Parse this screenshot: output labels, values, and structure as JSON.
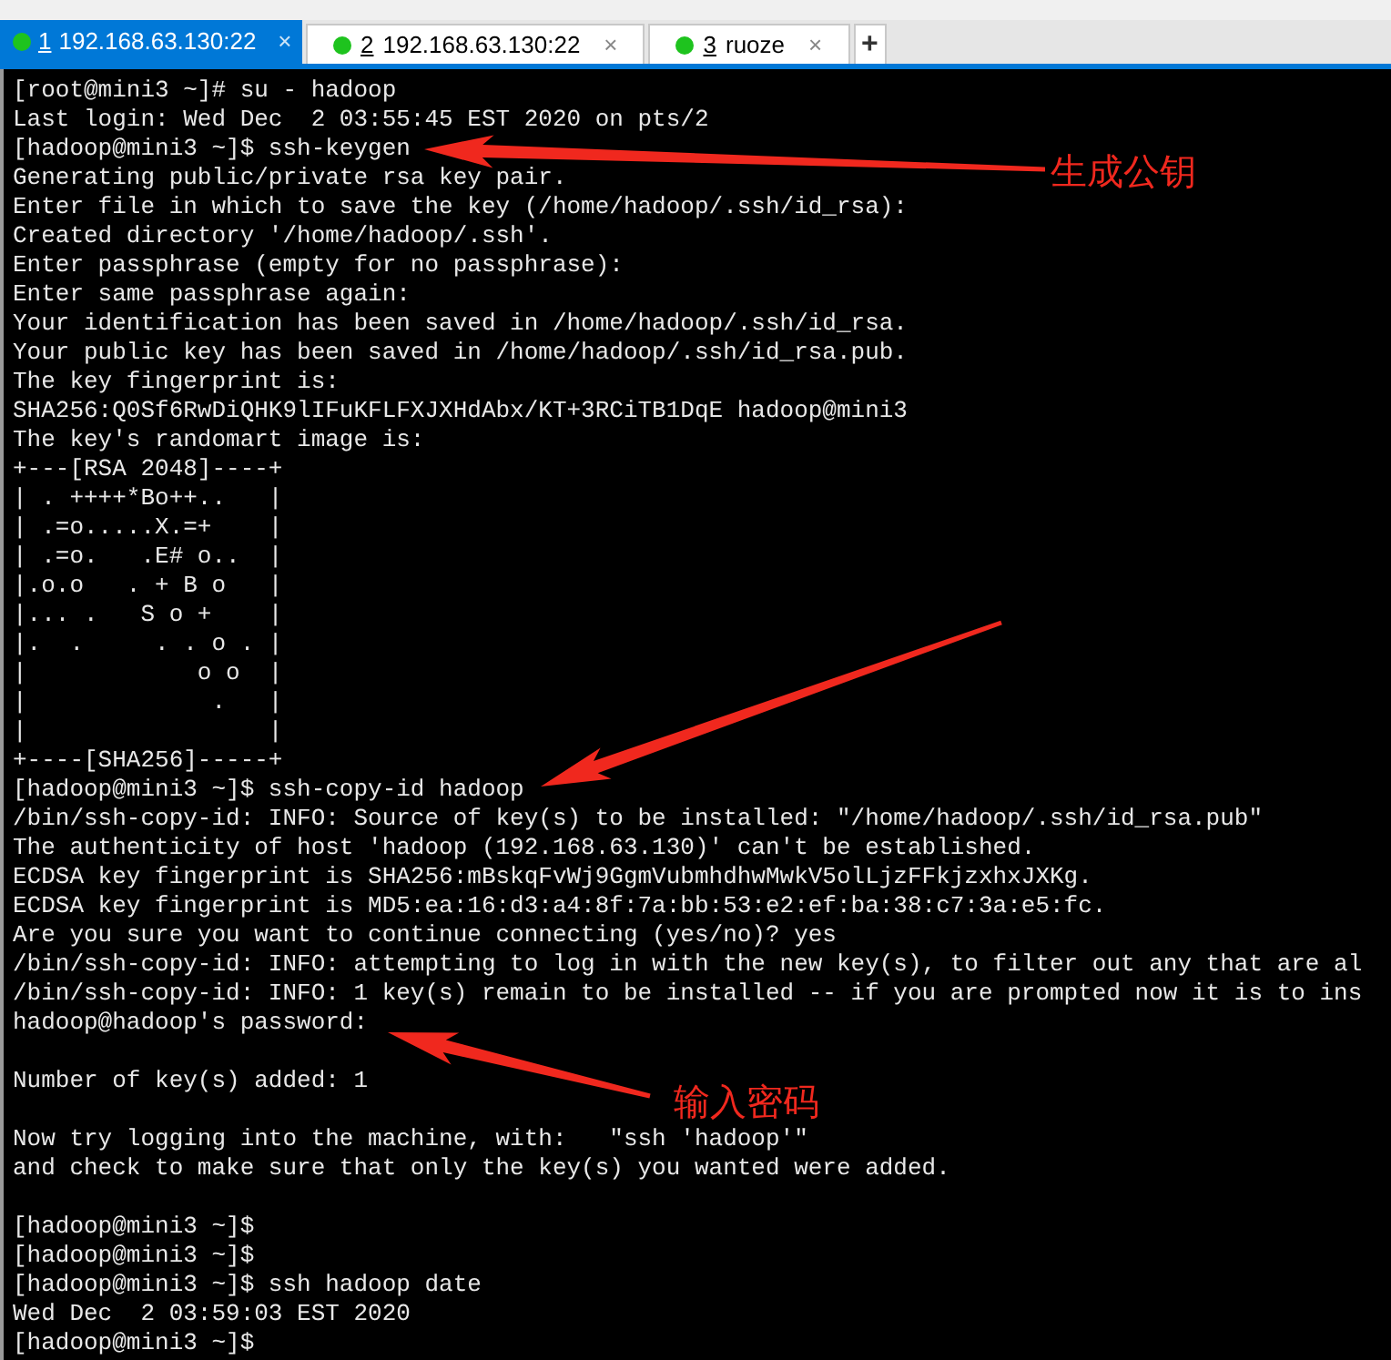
{
  "tabs": [
    {
      "number": "1",
      "label": "192.168.63.130:22",
      "close": "×",
      "selected": true
    },
    {
      "number": "2",
      "label": "192.168.63.130:22",
      "close": "×",
      "selected": false
    },
    {
      "number": "3",
      "label": "ruoze",
      "close": "×",
      "selected": false
    }
  ],
  "new_tab": "+",
  "terminal": {
    "lines": [
      {
        "kind": "text",
        "text": "[root@mini3 ~]# su - hadoop"
      },
      {
        "kind": "text",
        "text": "Last login: Wed Dec  2 03:55:45 EST 2020 on pts/2"
      },
      {
        "kind": "text",
        "text": "[hadoop@mini3 ~]$ ssh-keygen"
      },
      {
        "kind": "text",
        "text": "Generating public/private rsa key pair."
      },
      {
        "kind": "text",
        "text": "Enter file in which to save the key (/home/hadoop/.ssh/id_rsa):"
      },
      {
        "kind": "text",
        "text": "Created directory '/home/hadoop/.ssh'."
      },
      {
        "kind": "text",
        "text": "Enter passphrase (empty for no passphrase):"
      },
      {
        "kind": "text",
        "text": "Enter same passphrase again:"
      },
      {
        "kind": "text",
        "text": "Your identification has been saved in /home/hadoop/.ssh/id_rsa."
      },
      {
        "kind": "text",
        "text": "Your public key has been saved in /home/hadoop/.ssh/id_rsa.pub."
      },
      {
        "kind": "text",
        "text": "The key fingerprint is:"
      },
      {
        "kind": "text",
        "text": "SHA256:Q0Sf6RwDiQHK9lIFuKFLFXJXHdAbx/KT+3RCiTB1DqE hadoop@mini3"
      },
      {
        "kind": "text",
        "text": "The key's randomart image is:"
      },
      {
        "kind": "text",
        "text": "+---[RSA 2048]----+"
      },
      {
        "kind": "text",
        "text": "| . ++++*Bo++..   |"
      },
      {
        "kind": "text",
        "text": "| .=o.....X.=+    |"
      },
      {
        "kind": "text",
        "text": "| .=o.   .E# o..  |"
      },
      {
        "kind": "text",
        "text": "|.o.o   . + B o   |"
      },
      {
        "kind": "text",
        "text": "|... .   S o +    |"
      },
      {
        "kind": "text",
        "text": "|.  .     . . o . |"
      },
      {
        "kind": "text",
        "text": "|            o o  |"
      },
      {
        "kind": "text",
        "text": "|             .   |"
      },
      {
        "kind": "text",
        "text": "|                 |"
      },
      {
        "kind": "text",
        "text": "+----[SHA256]-----+"
      },
      {
        "kind": "text",
        "text": "[hadoop@mini3 ~]$ ssh-copy-id hadoop"
      },
      {
        "kind": "text",
        "text": "/bin/ssh-copy-id: INFO: Source of key(s) to be installed: \"/home/hadoop/.ssh/id_rsa.pub\""
      },
      {
        "kind": "text",
        "text": "The authenticity of host 'hadoop (192.168.63.130)' can't be established."
      },
      {
        "kind": "text",
        "text": "ECDSA key fingerprint is SHA256:mBskqFvWj9GgmVubmhdhwMwkV5olLjzFFkjzxhxJXKg."
      },
      {
        "kind": "text",
        "text": "ECDSA key fingerprint is MD5:ea:16:d3:a4:8f:7a:bb:53:e2:ef:ba:38:c7:3a:e5:fc."
      },
      {
        "kind": "text",
        "text": "Are you sure you want to continue connecting (yes/no)? yes"
      },
      {
        "kind": "text",
        "text": "/bin/ssh-copy-id: INFO: attempting to log in with the new key(s), to filter out any that are al"
      },
      {
        "kind": "text",
        "text": "/bin/ssh-copy-id: INFO: 1 key(s) remain to be installed -- if you are prompted now it is to ins"
      },
      {
        "kind": "text",
        "text": "hadoop@hadoop's password:"
      },
      {
        "kind": "blank"
      },
      {
        "kind": "text",
        "text": "Number of key(s) added: 1"
      },
      {
        "kind": "blank"
      },
      {
        "kind": "text",
        "text": "Now try logging into the machine, with:   \"ssh 'hadoop'\""
      },
      {
        "kind": "text",
        "text": "and check to make sure that only the key(s) you wanted were added."
      },
      {
        "kind": "blank"
      },
      {
        "kind": "text",
        "text": "[hadoop@mini3 ~]$"
      },
      {
        "kind": "text",
        "text": "[hadoop@mini3 ~]$"
      },
      {
        "kind": "text",
        "text": "[hadoop@mini3 ~]$ ssh hadoop date"
      },
      {
        "kind": "text",
        "text": "Wed Dec  2 03:59:03 EST 2020"
      },
      {
        "kind": "text",
        "text": "[hadoop@mini3 ~]$"
      }
    ]
  },
  "annotations": [
    {
      "label": "生成公钥"
    },
    {
      "label": "输入密码"
    }
  ]
}
